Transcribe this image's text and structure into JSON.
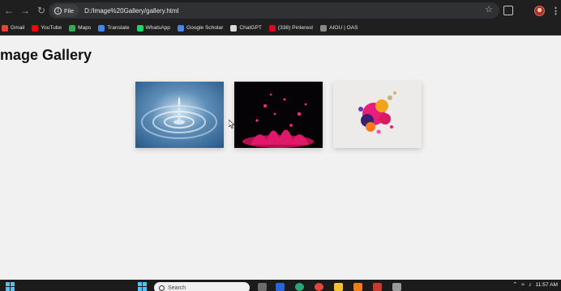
{
  "browser": {
    "url_chip": "File",
    "url": "D:/Image%20Gallery/gallery.html"
  },
  "bookmarks": [
    {
      "label": "Gmail",
      "icon": "gmail-icon",
      "color": "#ea4335"
    },
    {
      "label": "YouTube",
      "icon": "youtube-icon",
      "color": "#ff0000"
    },
    {
      "label": "Maps",
      "icon": "maps-icon",
      "color": "#34a853"
    },
    {
      "label": "Translate",
      "icon": "translate-icon",
      "color": "#4285f4"
    },
    {
      "label": "WhatsApp",
      "icon": "whatsapp-icon",
      "color": "#25d366"
    },
    {
      "label": "Google Scholar",
      "icon": "scholar-icon",
      "color": "#4a86e8"
    },
    {
      "label": "ChatGPT",
      "icon": "chatgpt-icon",
      "color": "#d9d9d9"
    },
    {
      "label": "(338) Pinterest",
      "icon": "pinterest-icon",
      "color": "#e60023"
    },
    {
      "label": "AIOU | OAS",
      "icon": "aiou-icon",
      "color": "#8a8a8a"
    }
  ],
  "page": {
    "title": "Image Gallery",
    "images": [
      {
        "name": "water-drop-image",
        "alt": "blue water drop ripple"
      },
      {
        "name": "pink-splash-image",
        "alt": "pink liquid splash on black"
      },
      {
        "name": "paint-splash-image",
        "alt": "colorful paint splash on white"
      }
    ]
  },
  "taskbar": {
    "search_placeholder": "Search",
    "time": "11:57 AM"
  }
}
